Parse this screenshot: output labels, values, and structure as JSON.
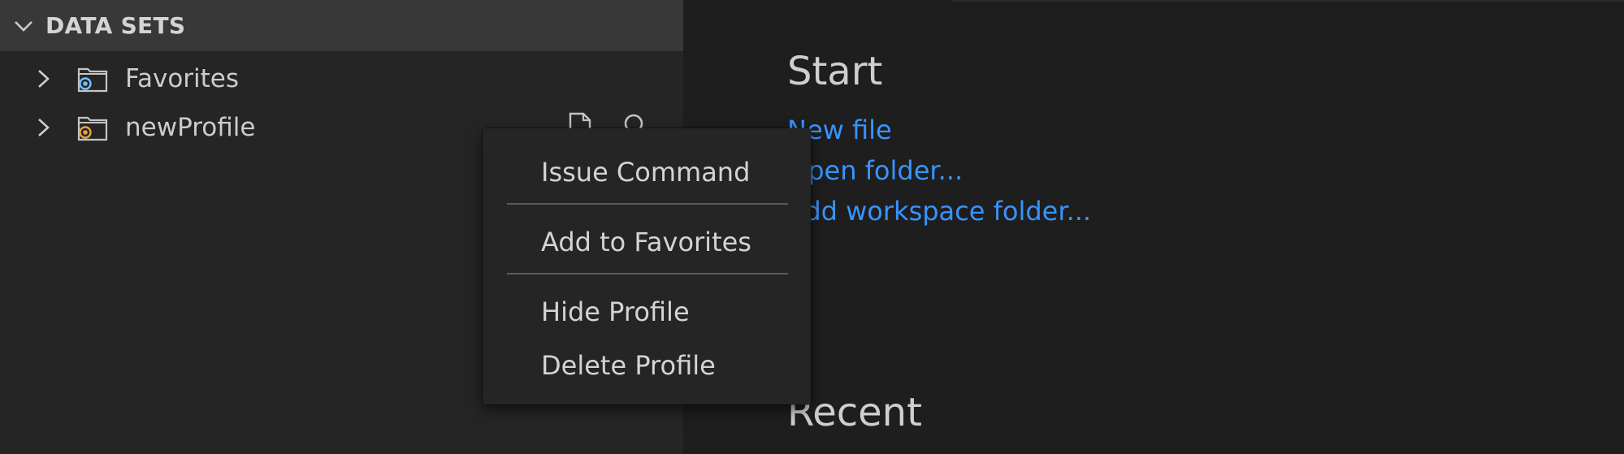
{
  "sidebar": {
    "section_title": "DATA SETS",
    "items": [
      {
        "label": "Favorites",
        "icon": "folder-favorites-icon",
        "icon_color": "#75beff"
      },
      {
        "label": "newProfile",
        "icon": "folder-profile-icon",
        "icon_color": "#e8a33d"
      }
    ]
  },
  "context_menu": {
    "items": [
      {
        "label": "Issue Command"
      },
      {
        "label": "Add to Favorites"
      },
      {
        "label": "Hide Profile"
      },
      {
        "label": "Delete Profile"
      }
    ]
  },
  "welcome": {
    "start_heading": "Start",
    "links": [
      {
        "label": "New file"
      },
      {
        "label": "Open folder..."
      },
      {
        "label": "Add workspace folder..."
      }
    ],
    "recent_heading": "Recent"
  },
  "colors": {
    "link": "#3794ff",
    "sidebar_bg": "#252526",
    "editor_bg": "#1e1e1e",
    "header_bg": "#383838"
  }
}
